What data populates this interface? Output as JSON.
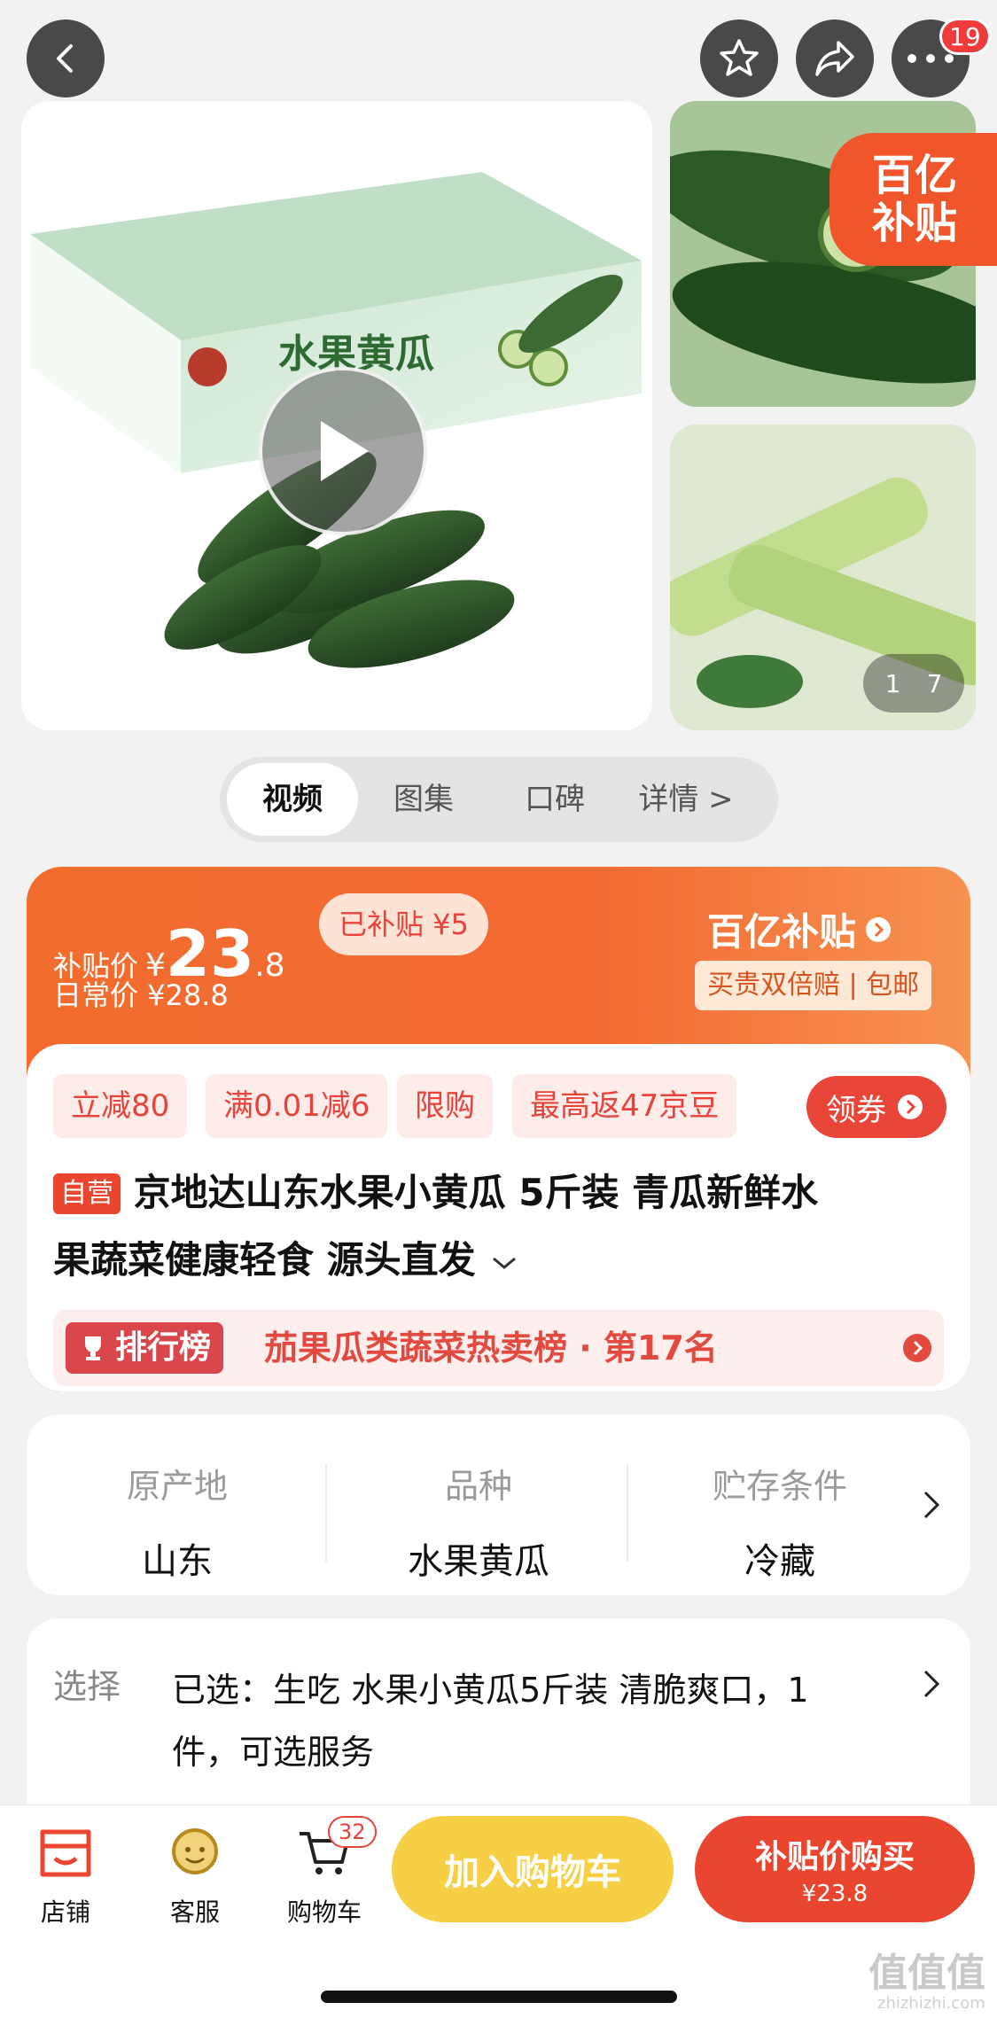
{
  "header": {
    "badge_count": "19"
  },
  "gallery": {
    "box_title": "水果黄瓜",
    "subsidy_tag_line1": "百亿",
    "subsidy_tag_line2": "补贴",
    "counter_current": "1",
    "counter_total": "7"
  },
  "tabs": [
    {
      "label": "视频",
      "active": true
    },
    {
      "label": "图集",
      "active": false
    },
    {
      "label": "口碑",
      "active": false
    },
    {
      "label": "详情 >",
      "active": false
    }
  ],
  "price": {
    "subsidy_label": "补贴价",
    "currency": "¥",
    "amount_main": "23",
    "amount_decimal": ".8",
    "subsidized_label": "已补贴 ¥5",
    "regular_label": "日常价 ¥28.8",
    "brand_title": "百亿补贴",
    "guarantee": "买贵双倍赔 | 包邮"
  },
  "promos": [
    "立减80",
    "满0.01减6",
    "限购",
    "最高返47京豆"
  ],
  "coupon_label": "领券",
  "product": {
    "self_tag": "自营",
    "title_line1": "京地达山东水果小黄瓜 5斤装 青瓜新鲜水",
    "title_line2": "果蔬菜健康轻食 源头直发"
  },
  "ranking": {
    "badge": "排行榜",
    "text": "茄果瓜类蔬菜热卖榜 · 第17名"
  },
  "attributes": [
    {
      "label": "原产地",
      "value": "山东"
    },
    {
      "label": "品种",
      "value": "水果黄瓜"
    },
    {
      "label": "贮存条件",
      "value": "冷藏"
    }
  ],
  "selection": {
    "label": "选择",
    "line1": "已选：生吃 水果小黄瓜5斤装 清脆爽口，1",
    "line2": "件，可选服务"
  },
  "bottom_nav": {
    "store": "店铺",
    "service": "客服",
    "cart": "购物车",
    "cart_count": "32",
    "add_to_cart": "加入购物车",
    "buy_label": "补贴价购买",
    "buy_price": "¥23.8"
  },
  "watermark": {
    "main": "值值值",
    "sub": "zhizhizhi.com"
  },
  "colors": {
    "accent_red": "#e9452f",
    "accent_orange": "#f26c2e",
    "cart_yellow": "#f7cf45"
  }
}
